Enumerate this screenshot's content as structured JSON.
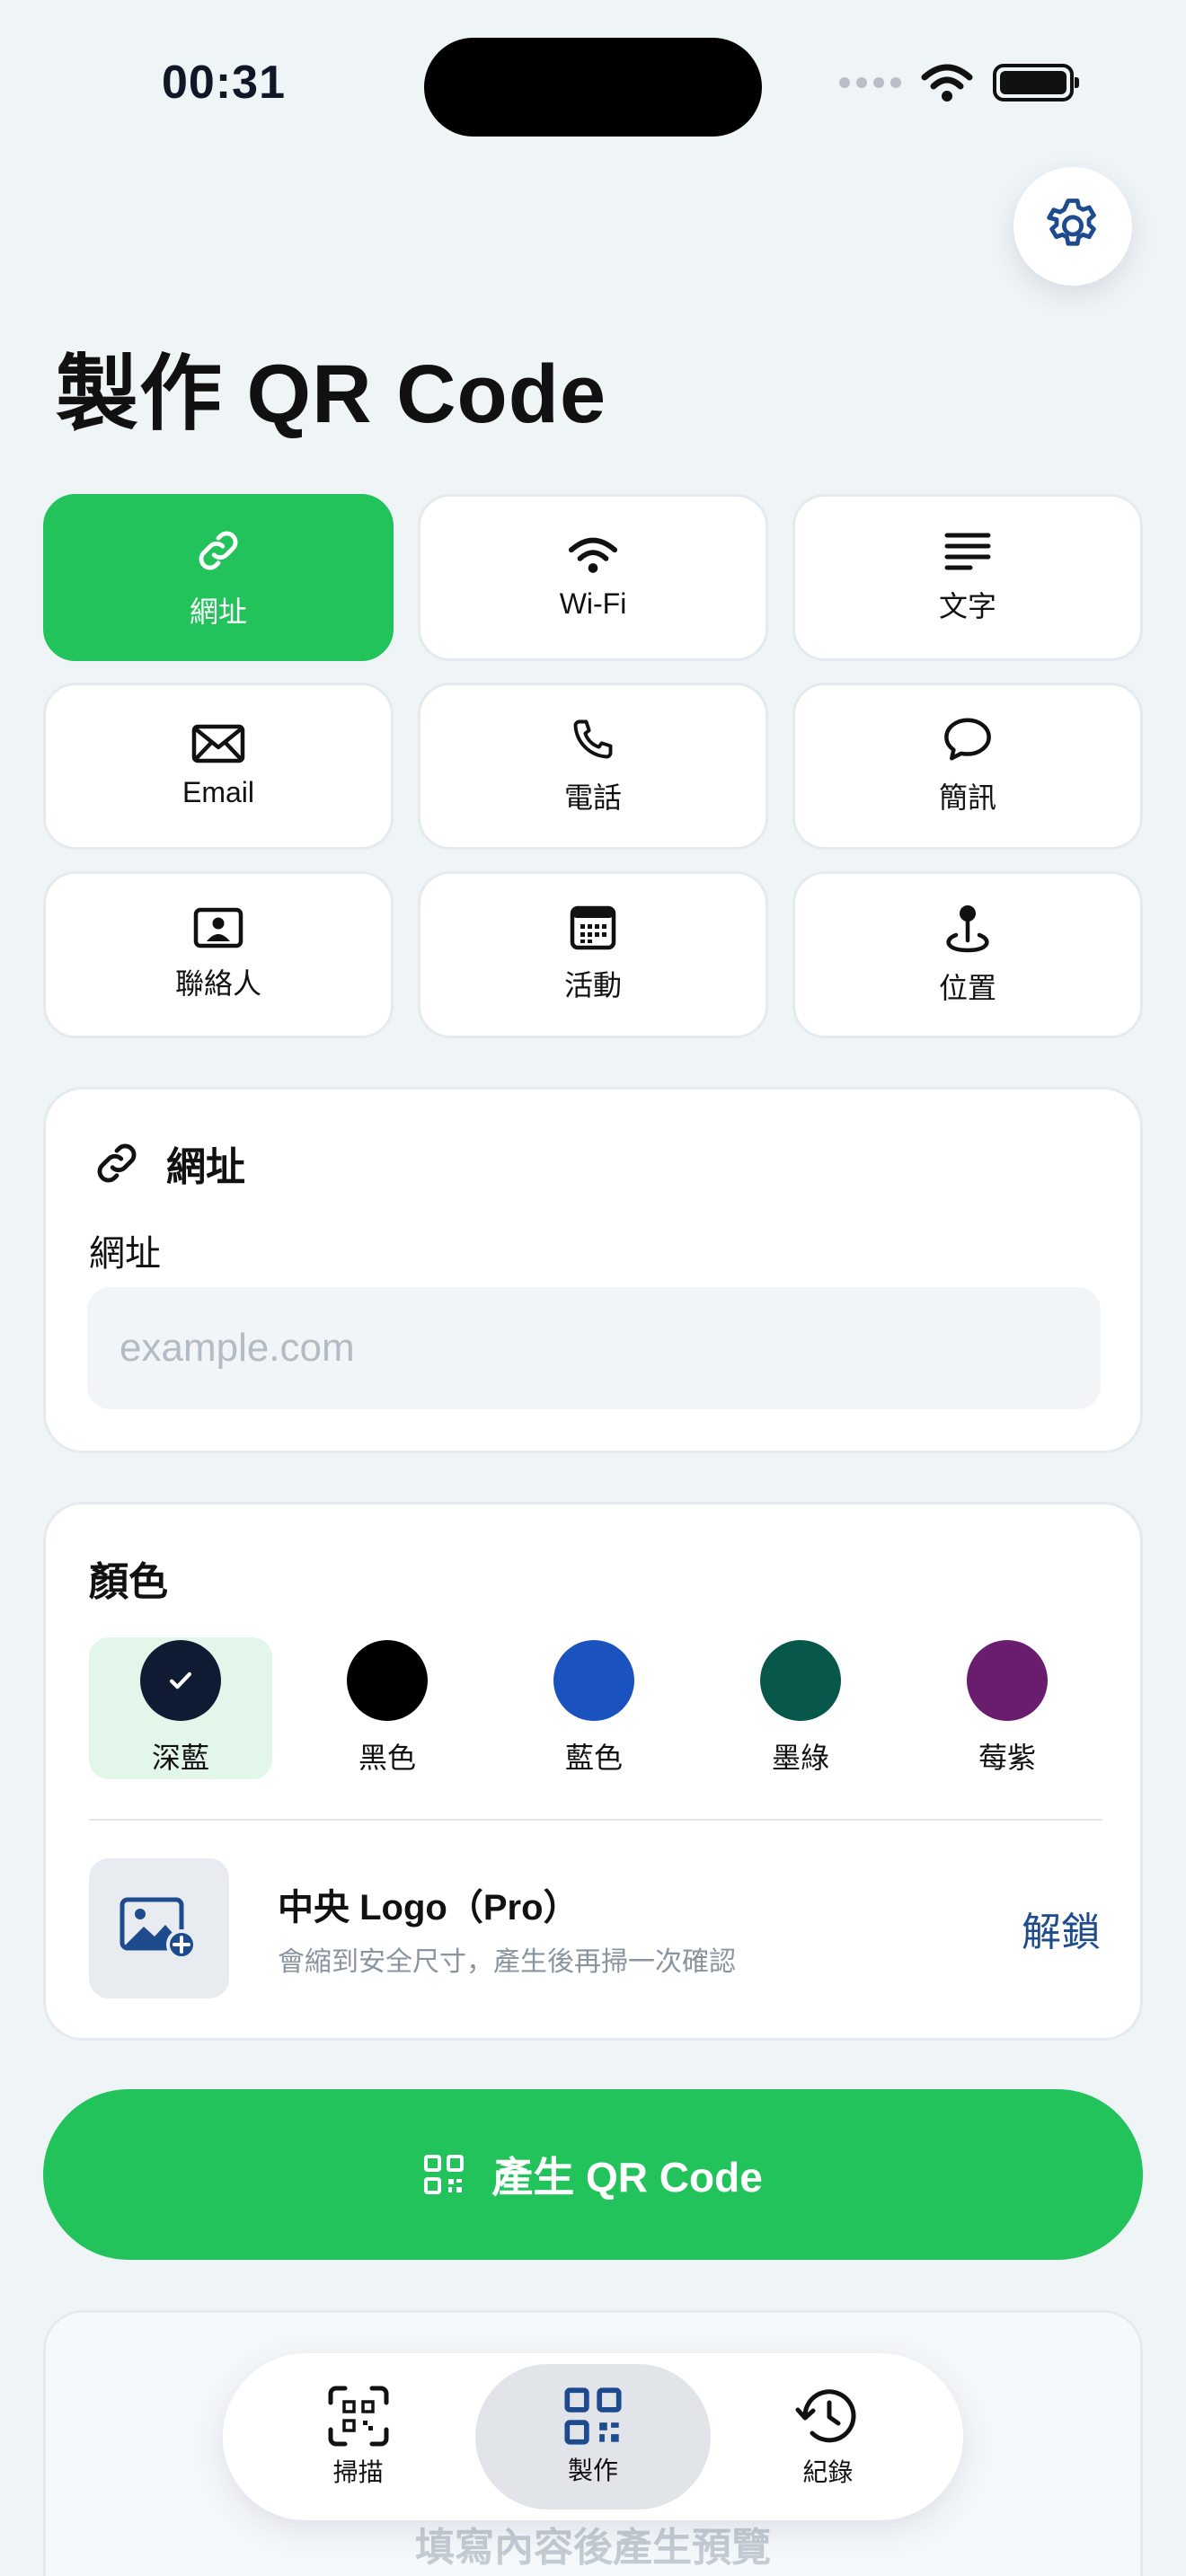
{
  "status": {
    "time": "00:31"
  },
  "title": "製作 QR Code",
  "types": [
    {
      "label": "網址",
      "icon": "link-icon",
      "active": true
    },
    {
      "label": "Wi-Fi",
      "icon": "wifi-icon",
      "active": false
    },
    {
      "label": "文字",
      "icon": "text-lines-icon",
      "active": false
    },
    {
      "label": "Email",
      "icon": "envelope-icon",
      "active": false
    },
    {
      "label": "電話",
      "icon": "phone-icon",
      "active": false
    },
    {
      "label": "簡訊",
      "icon": "message-bubble-icon",
      "active": false
    },
    {
      "label": "聯絡人",
      "icon": "contact-card-icon",
      "active": false
    },
    {
      "label": "活動",
      "icon": "calendar-icon",
      "active": false
    },
    {
      "label": "位置",
      "icon": "location-pin-icon",
      "active": false
    }
  ],
  "url_card": {
    "heading": "網址",
    "field_label": "網址",
    "placeholder": "example.com",
    "value": ""
  },
  "color_card": {
    "title": "顏色",
    "swatches": [
      {
        "label": "深藍",
        "color": "#0f1b33",
        "selected": true
      },
      {
        "label": "黑色",
        "color": "#000000",
        "selected": false
      },
      {
        "label": "藍色",
        "color": "#1a52c0",
        "selected": false
      },
      {
        "label": "墨綠",
        "color": "#07584a",
        "selected": false
      },
      {
        "label": "莓紫",
        "color": "#6a1c6e",
        "selected": false
      }
    ],
    "logo": {
      "title": "中央 Logo（Pro）",
      "subtitle": "會縮到安全尺寸，產生後再掃一次確認",
      "action": "解鎖"
    }
  },
  "generate_label": "產生 QR Code",
  "preview_hint": "填寫內容後產生預覽",
  "tabs": [
    {
      "label": "掃描",
      "icon": "scan-qr-icon",
      "active": false
    },
    {
      "label": "製作",
      "icon": "qr-code-icon",
      "active": true
    },
    {
      "label": "紀錄",
      "icon": "history-icon",
      "active": false
    }
  ],
  "colors": {
    "accent": "#23c35c",
    "link": "#1e4b8e",
    "background": "#eff4f7"
  }
}
